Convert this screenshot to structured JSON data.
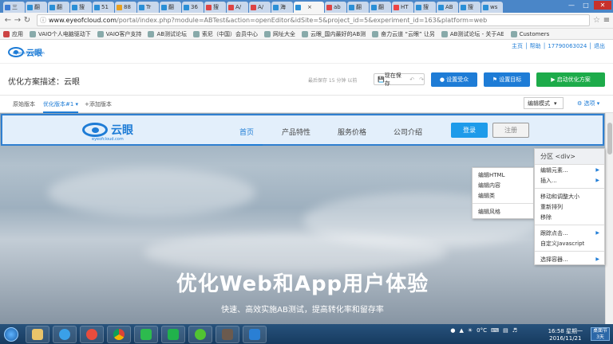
{
  "browser": {
    "tabs": [
      {
        "label": "三",
        "color": "#3b7bd4"
      },
      {
        "label": "翻",
        "color": "#2a8fd6"
      },
      {
        "label": "翻",
        "color": "#2a8fd6"
      },
      {
        "label": "搜",
        "color": "#2a8fd6"
      },
      {
        "label": "51",
        "color": "#2a8fd6"
      },
      {
        "label": "88",
        "color": "#e8a020"
      },
      {
        "label": "Tr",
        "color": "#2a8fd6"
      },
      {
        "label": "翻",
        "color": "#2a8fd6"
      },
      {
        "label": "36",
        "color": "#2a8fd6"
      },
      {
        "label": "搜",
        "color": "#d44"
      },
      {
        "label": "A/",
        "color": "#d44"
      },
      {
        "label": "A/",
        "color": "#d44"
      },
      {
        "label": "海",
        "color": "#2a8fd6"
      },
      {
        "label": "",
        "color": "#2a8fd6",
        "active": true
      },
      {
        "label": "ab",
        "color": "#d44"
      },
      {
        "label": "翻",
        "color": "#2a8fd6"
      },
      {
        "label": "翻",
        "color": "#2a8fd6"
      },
      {
        "label": "HT",
        "color": "#e44"
      },
      {
        "label": "搜",
        "color": "#2a8fd6"
      },
      {
        "label": "AB",
        "color": "#2a8fd6"
      },
      {
        "label": "搜",
        "color": "#2a8fd6"
      },
      {
        "label": "ws",
        "color": "#2a8fd6"
      }
    ],
    "url_host": "www.eyeofcloud.com",
    "url_path": "/portal/index.php?module=ABTest&action=openEditor&idSite=5&project_id=5&experiment_id=163&platform=web",
    "bookmarks": [
      "应用",
      "VAIO个人电脑驱动下",
      "VAIO客户支持",
      "AB测试论坛",
      "索尼（中国）会员中心",
      "网址大全",
      "云眼_国内最好的AB测",
      "奋力云道 “云眼” 让另",
      "AB测试论坛 - 关于AE",
      "Customers"
    ]
  },
  "editor": {
    "top_links": "主页 │ 帮助 │ 17790063024 │ 退出",
    "plan_title": "优化方案描述：云眼",
    "save_info": "最后保存 15 分钟 以前",
    "save_now": "现在保存",
    "btn_audience": "设置受众",
    "btn_goal": "设置目标",
    "btn_start": "启动优化方案",
    "tab_original": "原始版本",
    "tab_variant": "优化版本#1 ▾",
    "tab_add": "+添加版本",
    "mode": "编辑模式",
    "options": "选项",
    "logo_text": "云眼",
    "logo_sub": "eyeofcloud.com"
  },
  "site": {
    "logo_text": "云眼",
    "logo_sub": "eyeofcloud.com",
    "nav": [
      "首页",
      "产品特性",
      "服务价格",
      "公司介绍"
    ],
    "login": "登录",
    "register": "注册",
    "hero_title": "优化Web和App用户体验",
    "hero_sub": "快速、高效实施AB测试，提高转化率和留存率"
  },
  "menu_main": {
    "header": "分区 <div>",
    "groups": [
      [
        {
          "label": "编辑元素...",
          "sub": true
        },
        {
          "label": "插入...",
          "sub": true
        }
      ],
      [
        {
          "label": "移动和调整大小"
        },
        {
          "label": "重新排列"
        },
        {
          "label": "移除"
        }
      ],
      [
        {
          "label": "跟踪点击...",
          "sub": true
        },
        {
          "label": "自定义Javascript"
        }
      ],
      [
        {
          "label": "选择容器...",
          "sub": true
        }
      ]
    ]
  },
  "menu_sub": {
    "items": [
      "编辑HTML",
      "编辑内容",
      "编辑类",
      "编辑风格"
    ]
  },
  "taskbar": {
    "clock_time": "16:58 星期一",
    "clock_date": "2016/11/21",
    "temp": "0°C",
    "badge": "桌面节 3天"
  }
}
